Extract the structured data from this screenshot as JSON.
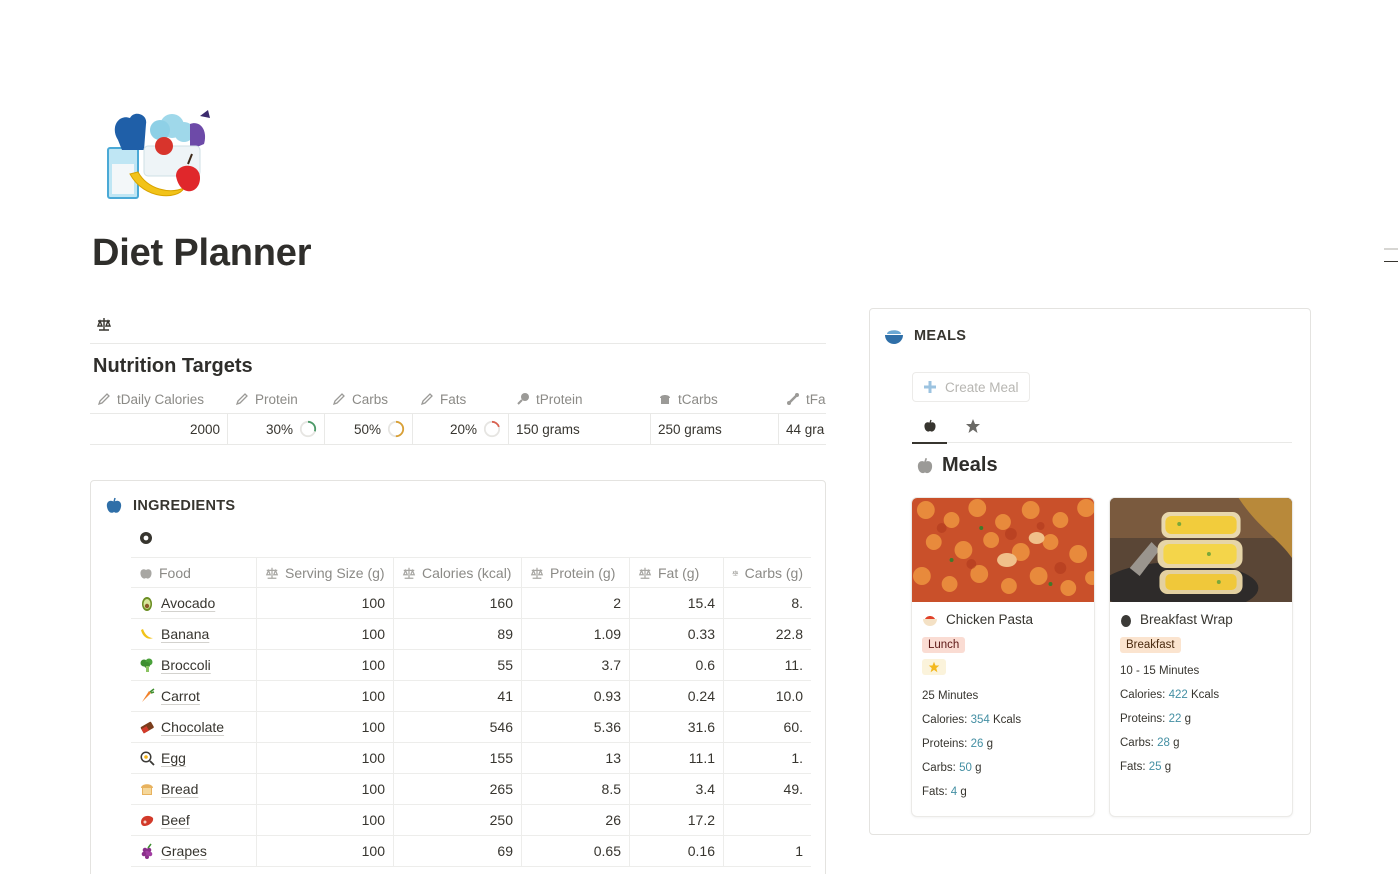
{
  "page": {
    "title": "Diet Planner"
  },
  "nutrition": {
    "title": "Nutrition Targets",
    "headers": [
      "tDaily Calories",
      "Protein",
      "Carbs",
      "Fats",
      "tProtein",
      "tCarbs",
      "tFa"
    ],
    "values": {
      "daily_calories": "2000",
      "protein_pct": "30%",
      "carbs_pct": "50%",
      "fats_pct": "20%",
      "protein_grams": "150 grams",
      "carbs_grams": "250 grams",
      "fats_grams": "44 gra"
    },
    "rings": {
      "protein": 0.3,
      "carbs": 0.5,
      "fats": 0.2
    },
    "ring_colors": {
      "protein": "#4c9a68",
      "carbs": "#d9a036",
      "fats": "#d9604f"
    }
  },
  "ingredients": {
    "title": "INGREDIENTS",
    "columns": [
      "Food",
      "Serving Size (g)",
      "Calories (kcal)",
      "Protein (g)",
      "Fat (g)",
      "Carbs (g)"
    ],
    "rows": [
      {
        "emoji": "avocado-icon",
        "food": "Avocado",
        "serving": "100",
        "calories": "160",
        "protein": "2",
        "fat": "15.4",
        "carbs": "8."
      },
      {
        "emoji": "banana-icon",
        "food": "Banana",
        "serving": "100",
        "calories": "89",
        "protein": "1.09",
        "fat": "0.33",
        "carbs": "22.8"
      },
      {
        "emoji": "broccoli-icon",
        "food": "Broccoli",
        "serving": "100",
        "calories": "55",
        "protein": "3.7",
        "fat": "0.6",
        "carbs": "11."
      },
      {
        "emoji": "carrot-icon",
        "food": "Carrot",
        "serving": "100",
        "calories": "41",
        "protein": "0.93",
        "fat": "0.24",
        "carbs": "10.0"
      },
      {
        "emoji": "chocolate-icon",
        "food": "Chocolate",
        "serving": "100",
        "calories": "546",
        "protein": "5.36",
        "fat": "31.6",
        "carbs": "60."
      },
      {
        "emoji": "egg-icon",
        "food": "Egg",
        "serving": "100",
        "calories": "155",
        "protein": "13",
        "fat": "11.1",
        "carbs": "1."
      },
      {
        "emoji": "bread-icon",
        "food": "Bread",
        "serving": "100",
        "calories": "265",
        "protein": "8.5",
        "fat": "3.4",
        "carbs": "49."
      },
      {
        "emoji": "beef-icon",
        "food": "Beef",
        "serving": "100",
        "calories": "250",
        "protein": "26",
        "fat": "17.2",
        "carbs": ""
      },
      {
        "emoji": "grapes-icon",
        "food": "Grapes",
        "serving": "100",
        "calories": "69",
        "protein": "0.65",
        "fat": "0.16",
        "carbs": "1"
      }
    ]
  },
  "meals": {
    "title": "MEALS",
    "create_label": "Create Meal",
    "gallery_title": "Meals",
    "cards": [
      {
        "name": "Chicken Pasta",
        "tag": "Lunch",
        "favorite": true,
        "time": "25 Minutes",
        "calories_label": "Calories:",
        "calories": "354",
        "calories_unit": "Kcals",
        "proteins_label": "Proteins:",
        "proteins": "26",
        "proteins_unit": "g",
        "carbs_label": "Carbs:",
        "carbs": "50",
        "carbs_unit": "g",
        "fats_label": "Fats:",
        "fats": "4",
        "fats_unit": "g"
      },
      {
        "name": "Breakfast Wrap",
        "tag": "Breakfast",
        "favorite": false,
        "time": "10 - 15 Minutes",
        "calories_label": "Calories:",
        "calories": "422",
        "calories_unit": "Kcals",
        "proteins_label": "Proteins:",
        "proteins": "22",
        "proteins_unit": "g",
        "carbs_label": "Carbs:",
        "carbs": "28",
        "carbs_unit": "g",
        "fats_label": "Fats:",
        "fats": "25",
        "fats_unit": "g"
      }
    ]
  },
  "colors": {
    "accent_blue": "#2f6fa8",
    "number_teal": "#448fa3",
    "lunch_tag": "#fadcd3",
    "breakfast_tag": "#fbe4cf"
  }
}
